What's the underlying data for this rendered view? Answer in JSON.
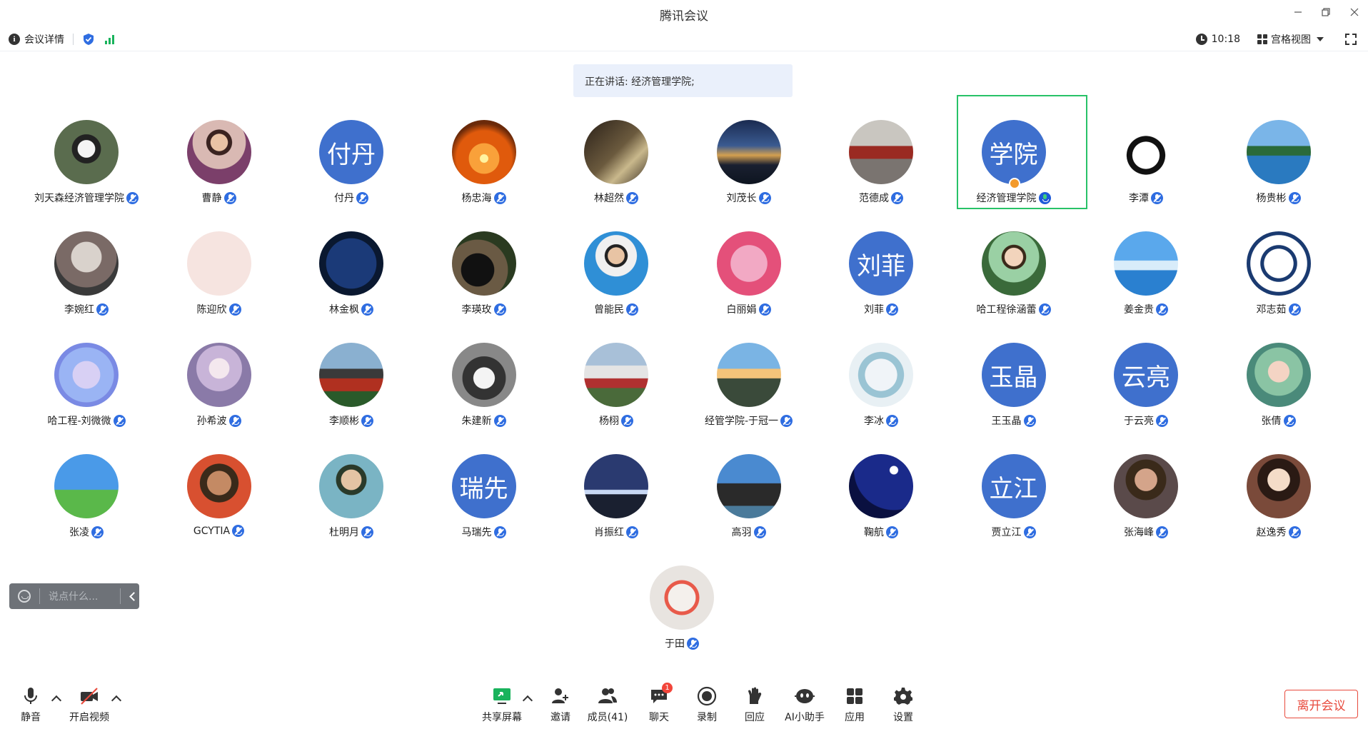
{
  "window": {
    "title": "腾讯会议"
  },
  "infobar": {
    "meeting_details": "会议详情",
    "time": "10:18",
    "view_mode": "宫格视图"
  },
  "speaking_banner": "正在讲话: 经济管理学院;",
  "participants": [
    {
      "name": "刘天森经济管理学院",
      "avatar": "photo"
    },
    {
      "name": "曹静",
      "avatar": "photo"
    },
    {
      "name": "付丹",
      "avatar_text": "付丹"
    },
    {
      "name": "杨忠海",
      "avatar": "photo"
    },
    {
      "name": "林超然",
      "avatar": "photo"
    },
    {
      "name": "刘茂长",
      "avatar": "photo"
    },
    {
      "name": "范德成",
      "avatar": "photo"
    },
    {
      "name": "经济管理学院",
      "avatar_text": "学院",
      "speaking": true,
      "host": true
    },
    {
      "name": "李潭",
      "avatar": "photo"
    },
    {
      "name": "杨贵彬",
      "avatar": "photo"
    },
    {
      "name": "李婉红",
      "avatar": "photo"
    },
    {
      "name": "陈迎欣",
      "avatar": "photo"
    },
    {
      "name": "林金枫",
      "avatar": "photo"
    },
    {
      "name": "李瑛玫",
      "avatar": "photo"
    },
    {
      "name": "曾能民",
      "avatar": "photo"
    },
    {
      "name": "白丽娟",
      "avatar": "photo"
    },
    {
      "name": "刘菲",
      "avatar_text": "刘菲"
    },
    {
      "name": "哈工程徐涵蕾",
      "avatar": "photo"
    },
    {
      "name": "姜金贵",
      "avatar": "photo"
    },
    {
      "name": "邓志茹",
      "avatar": "photo"
    },
    {
      "name": "哈工程-刘微微",
      "avatar": "photo"
    },
    {
      "name": "孙希波",
      "avatar": "photo"
    },
    {
      "name": "李顺彬",
      "avatar": "photo"
    },
    {
      "name": "朱建新",
      "avatar": "photo"
    },
    {
      "name": "杨栩",
      "avatar": "photo"
    },
    {
      "name": "经管学院-于冠一",
      "avatar": "photo"
    },
    {
      "name": "李冰",
      "avatar": "photo"
    },
    {
      "name": "王玉晶",
      "avatar_text": "玉晶"
    },
    {
      "name": "于云亮",
      "avatar_text": "云亮"
    },
    {
      "name": "张倩",
      "avatar": "photo"
    },
    {
      "name": "张凌",
      "avatar": "photo"
    },
    {
      "name": "GCYTIA",
      "avatar": "photo"
    },
    {
      "name": "杜明月",
      "avatar": "photo"
    },
    {
      "name": "马瑞先",
      "avatar_text": "瑞先"
    },
    {
      "name": "肖振红",
      "avatar": "photo"
    },
    {
      "name": "高羽",
      "avatar": "photo"
    },
    {
      "name": "鞠航",
      "avatar": "photo"
    },
    {
      "name": "贾立江",
      "avatar_text": "立江"
    },
    {
      "name": "张海峰",
      "avatar": "photo"
    },
    {
      "name": "赵逸秀",
      "avatar": "photo"
    },
    {
      "name": "于田",
      "avatar": "photo"
    }
  ],
  "chat": {
    "placeholder": "说点什么..."
  },
  "toolbar": {
    "mute": "静音",
    "video": "开启视频",
    "share": "共享屏幕",
    "invite": "邀请",
    "members": "成员(41)",
    "chat": "聊天",
    "chat_badge": "1",
    "record": "录制",
    "reactions": "回应",
    "ai_assistant": "AI小助手",
    "apps": "应用",
    "settings": "设置",
    "leave": "离开会议"
  },
  "colors": {
    "accent_blue": "#2f6de1",
    "speaking_green": "#28c268",
    "leave_red": "#e84a3d",
    "text_avatar_bg": "#3f70cd"
  }
}
